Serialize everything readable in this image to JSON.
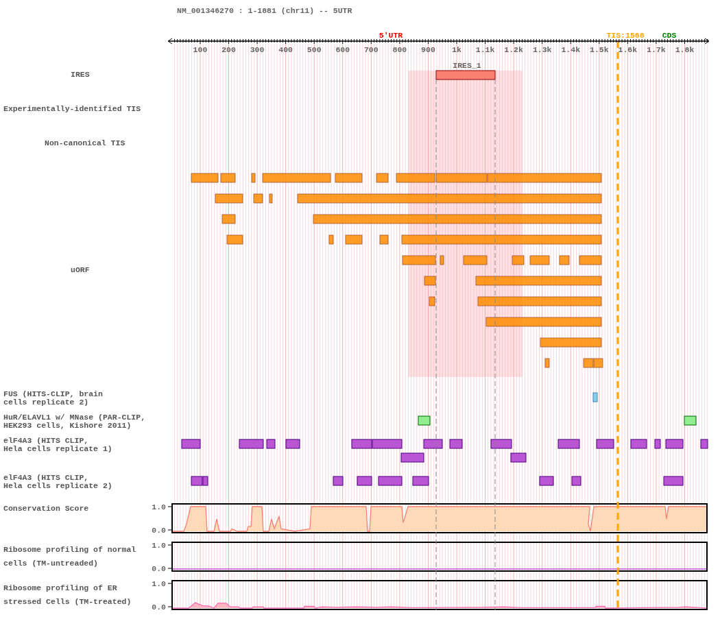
{
  "header": {
    "title": "NM_001346270 : 1-1881 (chr11) -- 5UTR"
  },
  "axis": {
    "region_label": "5'UTR",
    "tis_label": "TIS:1568",
    "cds_label": "CDS",
    "ticks": [
      "100",
      "200",
      "300",
      "400",
      "500",
      "600",
      "700",
      "800",
      "900",
      "1k",
      "1.1k",
      "1.2k",
      "1.3k",
      "1.4k",
      "1.5k",
      "1.6k",
      "1.7k",
      "1.8k"
    ]
  },
  "tracks": [
    {
      "kind": "ires",
      "label": "IRES",
      "feature_label": "IRES_1"
    },
    {
      "kind": "tis",
      "label": "Experimentally-identified TIS"
    },
    {
      "kind": "tis",
      "label": "Non-canonical TIS"
    },
    {
      "kind": "uorf",
      "label": "uORF"
    },
    {
      "kind": "clip",
      "label": "FUS (HITS-CLIP, brain\ncells replicate 2)"
    },
    {
      "kind": "clip",
      "label": "HuR/ELAVL1 w/ MNase (PAR-CLIP,\nHEK293 cells, Kishore 2011)"
    },
    {
      "kind": "clip",
      "label": "elF4A3 (HITS CLIP,\nHela cells replicate 1)"
    },
    {
      "kind": "clip",
      "label": "elF4A3 (HITS CLIP,\nHela cells replicate 2)"
    },
    {
      "kind": "signal",
      "label": "Conservation Score",
      "y_max": "1.0",
      "y_min": "0.0"
    },
    {
      "kind": "signal",
      "label": "Ribosome profiling of normal\ncells (TM-untreaded)",
      "y_max": "1.0",
      "y_min": "0.0"
    },
    {
      "kind": "signal",
      "label": "Ribosome profiling of ER\nstressed Cells (TM-treated)",
      "y_max": "1.0",
      "y_min": "0.0"
    }
  ]
}
